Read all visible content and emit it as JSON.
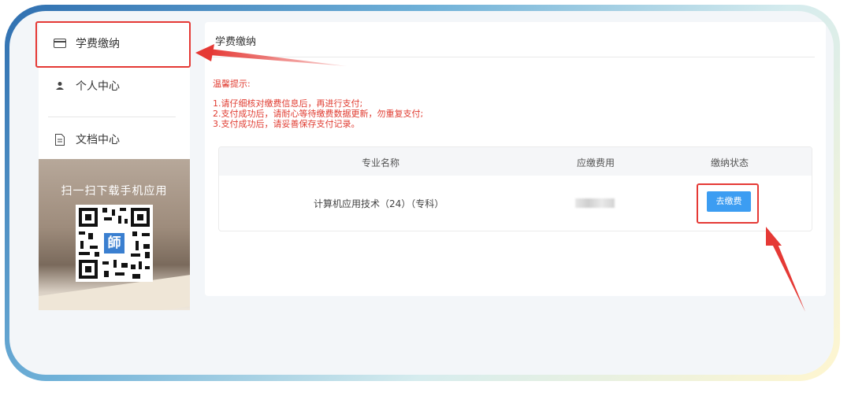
{
  "sidebar": {
    "items": [
      {
        "label": "学费缴纳",
        "icon": "card-icon"
      },
      {
        "label": "个人中心",
        "icon": "user-icon"
      },
      {
        "label": "文档中心",
        "icon": "document-icon"
      }
    ],
    "qr": {
      "title": "扫一扫下载手机应用",
      "icon": "qr-code-icon",
      "logo_text": "師"
    }
  },
  "main": {
    "title": "学费缴纳",
    "notice": {
      "heading": "温馨提示:",
      "lines": [
        "1.请仔细核对缴费信息后，再进行支付;",
        "2.支付成功后，请耐心等待缴费数据更新，勿重复支付;",
        "3.支付成功后，请妥善保存支付记录。"
      ]
    },
    "table": {
      "headers": [
        "专业名称",
        "应缴费用",
        "缴纳状态"
      ],
      "rows": [
        {
          "major": "计算机应用技术（24）（专科）",
          "fee": "",
          "status_button": "去缴费"
        }
      ]
    }
  },
  "annotation_color": "#e53935",
  "accent": "#3c9df2"
}
